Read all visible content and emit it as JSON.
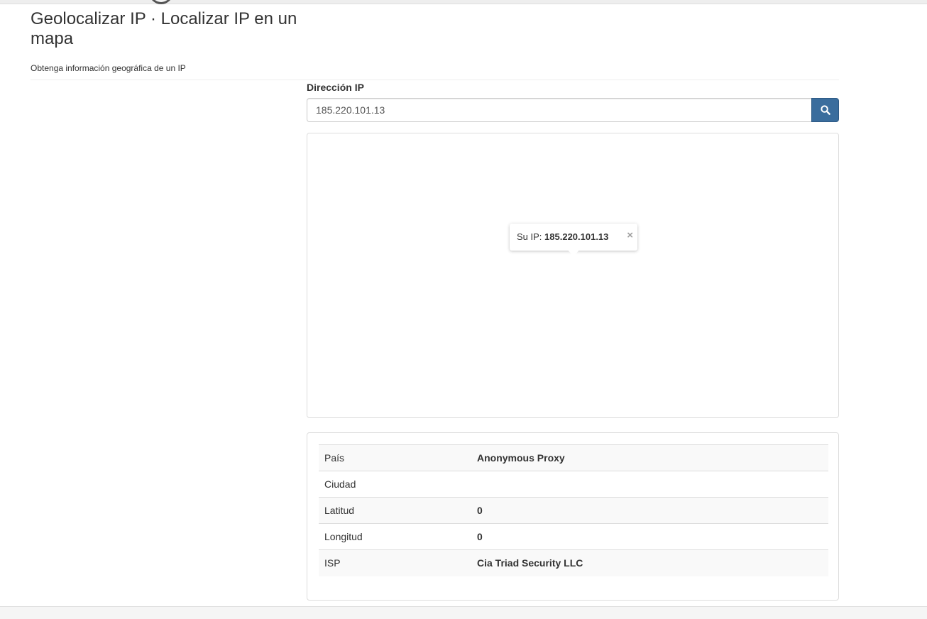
{
  "header": {
    "title": "Geolocalizar IP · Localizar IP en un mapa",
    "subtitle": "Obtenga información geográfica de un IP"
  },
  "search": {
    "label": "Dirección IP",
    "value": "185.220.101.13",
    "button_icon": "search-icon"
  },
  "map": {
    "popup": {
      "prefix": "Su IP: ",
      "ip": "185.220.101.13",
      "close_label": "×"
    }
  },
  "info": {
    "rows": [
      {
        "key": "País",
        "value": "Anonymous Proxy"
      },
      {
        "key": "Ciudad",
        "value": ""
      },
      {
        "key": "Latitud",
        "value": "0"
      },
      {
        "key": "Longitud",
        "value": "0"
      },
      {
        "key": "ISP",
        "value": "Cia Triad Security LLC"
      }
    ]
  },
  "colors": {
    "accent": "#3a6d9d",
    "border": "#dddddd",
    "stripe": "#f9f9f9"
  }
}
